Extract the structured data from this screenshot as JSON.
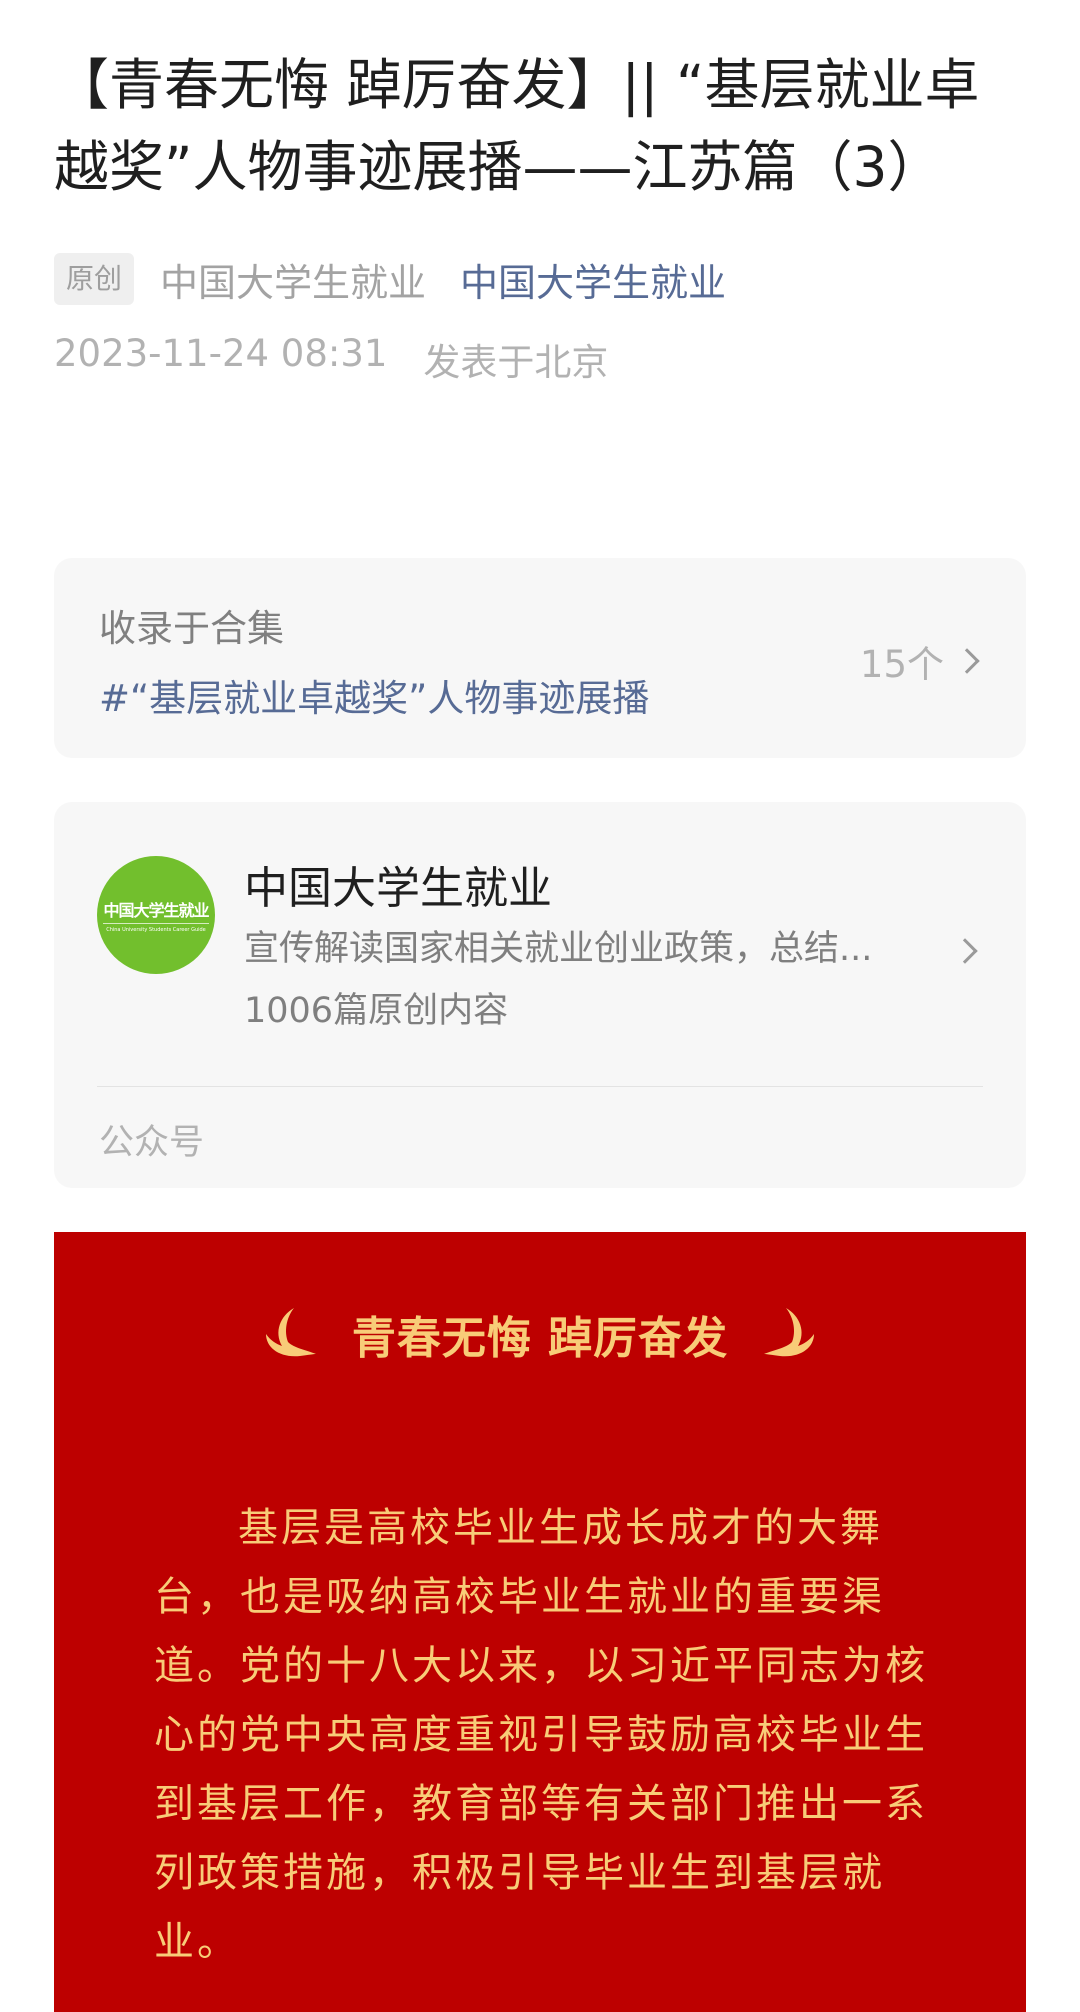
{
  "article": {
    "title": "【青春无悔 踔厉奋发】|| “基层就业卓越奖”人物事迹展播——江苏篇（3）",
    "original_badge": "原创",
    "author": "中国大学生就业",
    "account_link": "中国大学生就业",
    "date": "2023-11-24 08:31",
    "location": "发表于北京"
  },
  "collection": {
    "label": "收录于合集",
    "tag": "#“基层就业卓越奖”人物事迹展播",
    "count": "15个"
  },
  "account_card": {
    "avatar_text": "中国大学生就业",
    "avatar_subtext": "China University Students Career Guide",
    "name": "中国大学生就业",
    "description": "宣传解读国家相关就业创业政策，总结...",
    "original_count": "1006篇原创内容",
    "type_label": "公众号"
  },
  "banner": {
    "title": "青春无悔 踔厉奋发",
    "paragraph": "基层是高校毕业生成长成才的大舞台，也是吸纳高校毕业生就业的重要渠道。党的十八大以来，以习近平同志为核心的党中央高度重视引导鼓励高校毕业生到基层工作，教育部等有关部门推出一系列政策措施，积极引导毕业生到基层就业。",
    "colors": {
      "background": "#bd0000",
      "text": "#f8cc78"
    }
  },
  "icons": {
    "collection_arrow": "chevron-right-icon",
    "account_arrow": "chevron-right-icon",
    "banner_left": "bird-icon",
    "banner_right": "bird-icon"
  },
  "colors": {
    "link": "#576b95",
    "avatar_green": "#72bf2d"
  }
}
